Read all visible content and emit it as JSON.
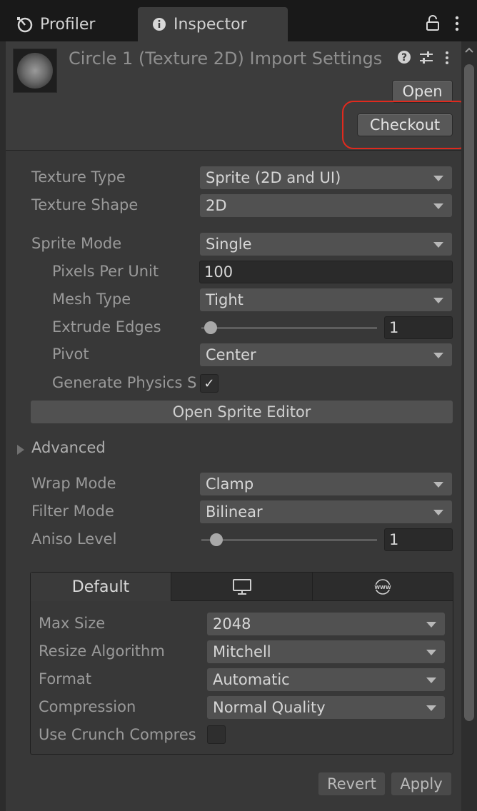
{
  "tabs": {
    "profiler": "Profiler",
    "inspector": "Inspector"
  },
  "header": {
    "title": "Circle 1 (Texture 2D) Import Settings",
    "open_label": "Open",
    "checkout_label": "Checkout",
    "help_glyph": "?"
  },
  "settings": {
    "texture_type": {
      "label": "Texture Type",
      "value": "Sprite (2D and UI)"
    },
    "texture_shape": {
      "label": "Texture Shape",
      "value": "2D"
    },
    "sprite_mode": {
      "label": "Sprite Mode",
      "value": "Single"
    },
    "pixels_per_unit": {
      "label": "Pixels Per Unit",
      "value": "100"
    },
    "mesh_type": {
      "label": "Mesh Type",
      "value": "Tight"
    },
    "extrude_edges": {
      "label": "Extrude Edges",
      "value": "1"
    },
    "pivot": {
      "label": "Pivot",
      "value": "Center"
    },
    "generate_physics": {
      "label": "Generate Physics S",
      "checked": true,
      "check_glyph": "✓"
    },
    "open_sprite_editor": "Open Sprite Editor",
    "advanced": "Advanced",
    "wrap_mode": {
      "label": "Wrap Mode",
      "value": "Clamp"
    },
    "filter_mode": {
      "label": "Filter Mode",
      "value": "Bilinear"
    },
    "aniso_level": {
      "label": "Aniso Level",
      "value": "1"
    }
  },
  "platform": {
    "tabs": {
      "default": "Default",
      "standalone_icon": "monitor-icon",
      "web_icon": "www-icon",
      "web_text": "WWW"
    },
    "max_size": {
      "label": "Max Size",
      "value": "2048"
    },
    "resize_algorithm": {
      "label": "Resize Algorithm",
      "value": "Mitchell"
    },
    "format": {
      "label": "Format",
      "value": "Automatic"
    },
    "compression": {
      "label": "Compression",
      "value": "Normal Quality"
    },
    "use_crunch": {
      "label": "Use Crunch Compres",
      "checked": false
    }
  },
  "footer": {
    "revert": "Revert",
    "apply": "Apply"
  },
  "colors": {
    "highlight": "#e02a1e",
    "background": "#383838",
    "tabbar": "#191919"
  }
}
